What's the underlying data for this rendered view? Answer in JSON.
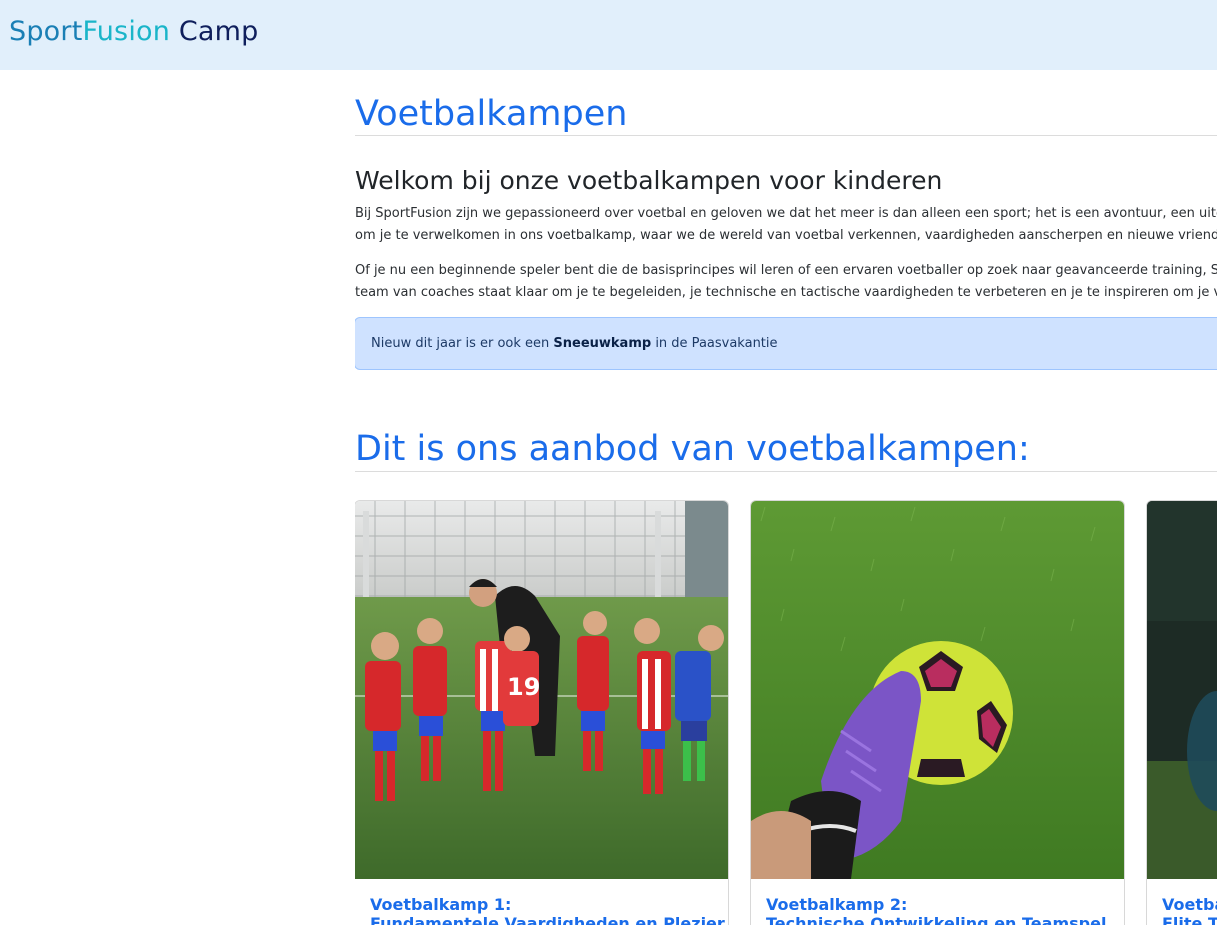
{
  "header": {
    "brand_part1": "Sport",
    "brand_part2": "Fusion",
    "brand_part3": " Camp"
  },
  "main": {
    "title": "Voetbalkampen",
    "welcome_heading": "Welkom bij onze voetbalkampen voor kinderen",
    "paragraph1_line1": "Bij SportFusion zijn we gepassioneerd over voetbal en geloven we dat het meer is dan alleen een sport; het is een avontuur, een uitdaging",
    "paragraph1_line2": "om je te verwelkomen in ons voetbalkamp, waar we de wereld van voetbal verkennen, vaardigheden aanscherpen en nieuwe vriendschappen",
    "paragraph2_line1": "Of je nu een beginnende speler bent die de basisprincipes wil leren of een ervaren voetballer op zoek naar geavanceerde training, SportFu",
    "paragraph2_line2": "team van coaches staat klaar om je te begeleiden, je technische en tactische vaardigheden te verbeteren en je te inspireren om je volledig",
    "alert_before": "Nieuw dit jaar is er ook een ",
    "alert_bold": "Sneeuwkamp",
    "alert_after": " in de Paasvakantie",
    "offer_heading": "Dit is ons aanbod van voetbalkampen:"
  },
  "cards": [
    {
      "title_line1": "Voetbalkamp 1:",
      "title_line2": "Fundamentele Vaardigheden en Plezier",
      "image": "kids-football-team-photo"
    },
    {
      "title_line1": "Voetbalkamp 2:",
      "title_line2": "Technische Ontwikkeling en Teamspel",
      "image": "football-and-boot-on-grass-photo"
    },
    {
      "title_line1": "Voetba",
      "title_line2": "Elite Tr",
      "image": "football-player-photo"
    }
  ],
  "colors": {
    "header_bg": "#e1effb",
    "accent_blue": "#1a6cea",
    "alert_bg": "#cfe2ff"
  }
}
